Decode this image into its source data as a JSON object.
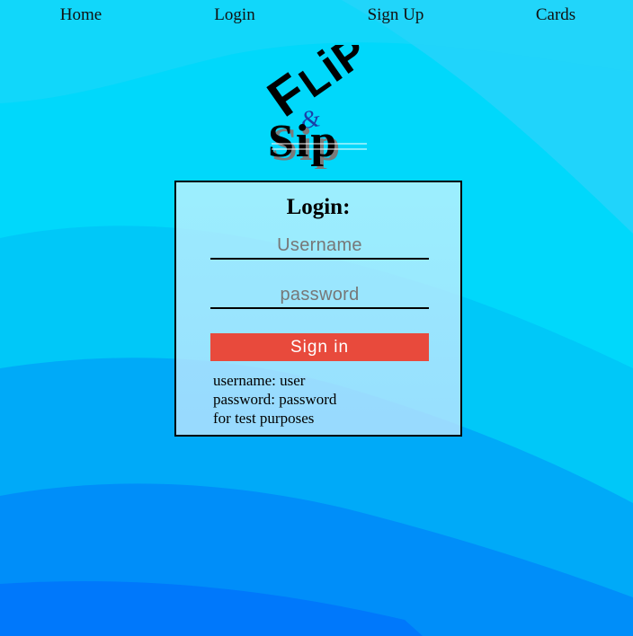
{
  "nav": {
    "items": [
      {
        "label": "Home"
      },
      {
        "label": "Login"
      },
      {
        "label": "Sign Up"
      },
      {
        "label": "Cards"
      }
    ]
  },
  "logo": {
    "text": "Flip & Sip"
  },
  "login": {
    "title": "Login:",
    "username_placeholder": "Username",
    "username_value": "",
    "password_placeholder": "password",
    "password_value": "",
    "submit_label": "Sign in",
    "hint_lines": [
      "username: user",
      "password: password",
      "for test purposes"
    ]
  },
  "colors": {
    "button": "#e84a3c",
    "background_top": "#00d4f8",
    "background_bottom": "#0077ff"
  }
}
